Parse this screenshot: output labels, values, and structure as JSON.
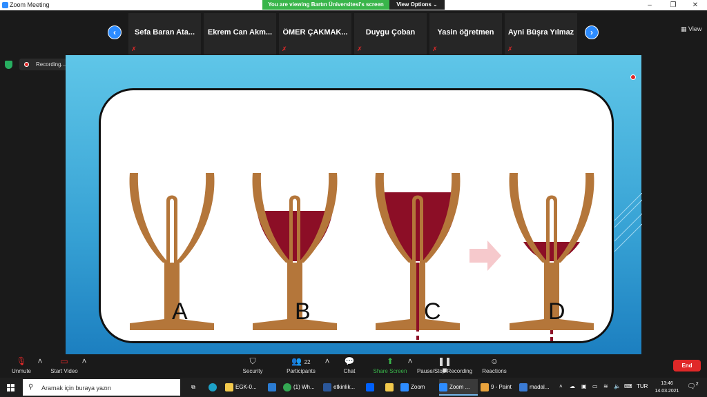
{
  "window": {
    "title": "Zoom Meeting",
    "minimize": "–",
    "restore": "❐",
    "close": "✕"
  },
  "banner": {
    "viewing_text": "You are viewing Bartın Üniversitesi's screen",
    "view_options_label": "View Options ⌄"
  },
  "participants_strip": {
    "prev_arrow": "‹",
    "next_arrow": "›",
    "view_label": "View",
    "participants": [
      {
        "name": "Sefa Baran Ata..."
      },
      {
        "name": "Ekrem Can Akm..."
      },
      {
        "name": "ÖMER ÇAKMAK..."
      },
      {
        "name": "Duygu Çoban"
      },
      {
        "name": "Yasin öğretmen"
      },
      {
        "name": "Ayni Büşra Yılmaz"
      }
    ],
    "muted_icon_glyph": "✗"
  },
  "recording": {
    "label": "Recording...",
    "controls": "❚❚  ■"
  },
  "shared_slide": {
    "labels": [
      "A",
      "B",
      "C",
      "D"
    ],
    "colors": {
      "cup": "#b4763a",
      "wine": "#8c0e26",
      "arrow": "#f6c9cc"
    }
  },
  "toolbar": {
    "unmute": "Unmute",
    "start_video": "Start Video",
    "security": "Security",
    "participants": "Participants",
    "participants_count": "22",
    "chat": "Chat",
    "share_screen": "Share Screen",
    "pause_stop_recording": "Pause/Stop Recording",
    "reactions": "Reactions",
    "end": "End"
  },
  "taskbar": {
    "search_placeholder": "Aramak için buraya yazın",
    "items": [
      {
        "label": "EGK-0...",
        "color": "#f2c94c"
      },
      {
        "label": "(1) Wh...",
        "color": "#34a853"
      },
      {
        "label": "etkinlik...",
        "color": "#2b579a"
      },
      {
        "label": "Zoom",
        "color": "#2d8cff"
      },
      {
        "label": "Zoom ...",
        "color": "#2d8cff"
      },
      {
        "label": "9 - Paint",
        "color": "#e8a33d"
      },
      {
        "label": "madal...",
        "color": "#3a7bd5"
      }
    ],
    "language": "TUR",
    "time": "13:46",
    "date": "14.03.2021",
    "notification_count": "2"
  }
}
